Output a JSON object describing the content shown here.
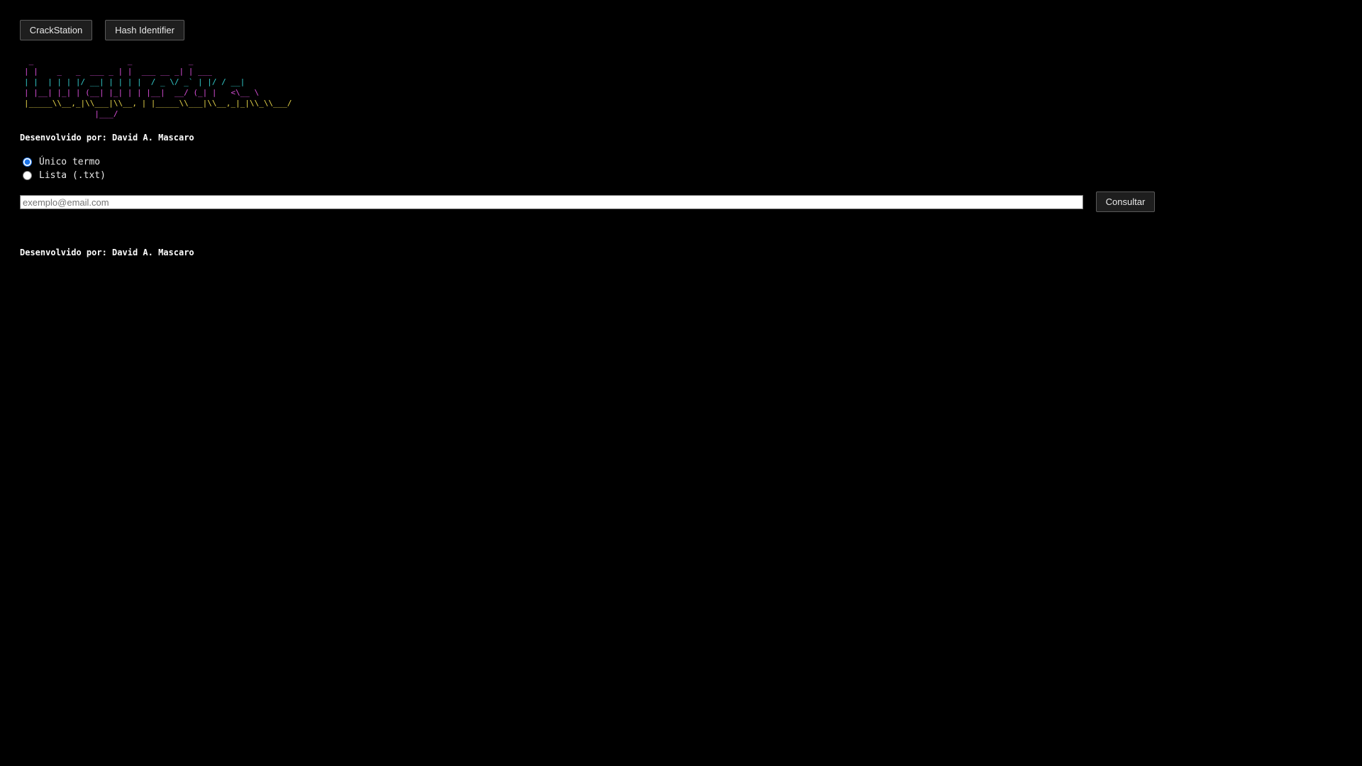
{
  "nav": {
    "buttons": [
      {
        "label": "CrackStation"
      },
      {
        "label": "Hash Identifier"
      }
    ]
  },
  "banner": {
    "lines": [
      {
        "text": " _                    _            _      ",
        "color": "#d94fd9"
      },
      {
        "text": "| |    _   _  ___ _ | |  ___ __ _| | ___",
        "color": "#d94fd9"
      },
      {
        "text": "| |  | | | |/ __| | | | |  / _ \\/ _` | |/ / __|",
        "color": "#33cccc"
      },
      {
        "text": "| |__| |_| | (__| |_| | | |__|  __/ (_| |   <\\__ \\",
        "color": "#d94fd9"
      },
      {
        "text": "|_____\\\\__,_|\\\\___|\\\\__, | |_____\\\\___|\\\\__,_|_|\\\\_\\\\___/",
        "color": "#e6d54a"
      },
      {
        "text": "               |___/",
        "color": "#d94fd9"
      }
    ]
  },
  "credit": {
    "top": "Desenvolvido por: David A. Mascaro",
    "bottom": "Desenvolvido por: David A. Mascaro"
  },
  "mode": {
    "options": [
      {
        "label": "Único termo",
        "checked": true
      },
      {
        "label": "Lista (.txt)",
        "checked": false
      }
    ]
  },
  "search": {
    "value": "",
    "placeholder": "exemplo@email.com",
    "submit_label": "Consultar"
  },
  "colors": {
    "background": "#000000",
    "magenta": "#d94fd9",
    "cyan": "#33cccc",
    "yellow": "#e6d54a",
    "button_bg": "#1e1e1e"
  }
}
